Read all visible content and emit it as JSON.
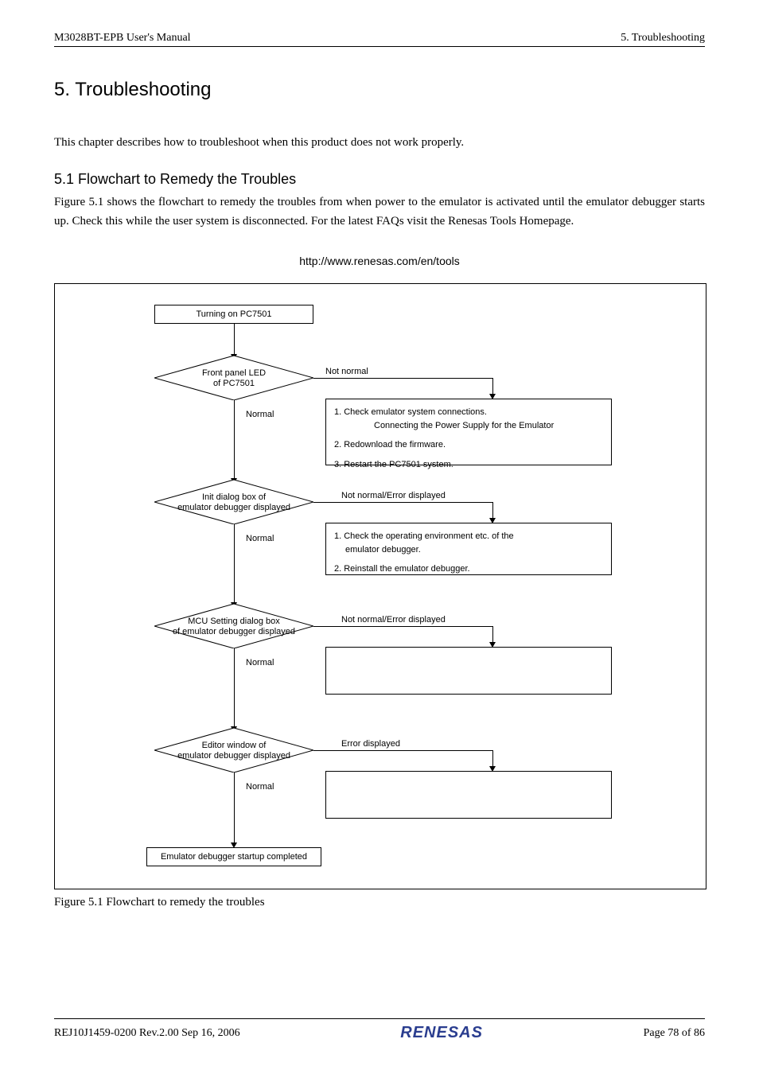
{
  "header": {
    "left": "M3028BT-EPB User's Manual",
    "right": "5. Troubleshooting"
  },
  "h1": "5. Troubleshooting",
  "intro": "This chapter describes how to troubleshoot when this product does not work properly.",
  "h2": "5.1 Flowchart to Remedy the Troubles",
  "para1": "Figure 5.1 shows the flowchart to remedy the troubles from when power to the emulator is activated until the emulator debugger starts up. Check this while the user system is disconnected. For the latest FAQs visit the Renesas Tools Homepage.",
  "url": "http://www.renesas.com/en/tools",
  "flow": {
    "start": "Turning on PC7501",
    "d1": "Front panel LED\nof PC7501",
    "d1_right": "Not normal",
    "d1_down": "Normal",
    "a1_1": "1. Check emulator system connections.",
    "a1_1b": "Connecting the Power Supply for the Emulator",
    "a1_2": "2. Redownload the firmware.",
    "a1_3": "3. Restart the PC7501 system.",
    "d2": "Init dialog box of\nemulator debugger displayed",
    "d2_right": "Not normal/Error displayed",
    "d2_down": "Normal",
    "a2_1": "1. Check the operating environment etc. of the",
    "a2_1b": "emulator debugger.",
    "a2_2": "2. Reinstall the emulator debugger.",
    "d3": "MCU Setting dialog box\nof emulator debugger displayed",
    "d3_right": "Not normal/Error displayed",
    "d3_down": "Normal",
    "d4": "Editor window of\nemulator debugger displayed",
    "d4_right": "Error displayed",
    "d4_down": "Normal",
    "end": "Emulator debugger startup completed"
  },
  "caption": "Figure 5.1 Flowchart to remedy the troubles",
  "footer": {
    "left": "REJ10J1459-0200   Rev.2.00   Sep 16, 2006",
    "logo": "RENESAS",
    "right": "Page 78 of 86"
  }
}
